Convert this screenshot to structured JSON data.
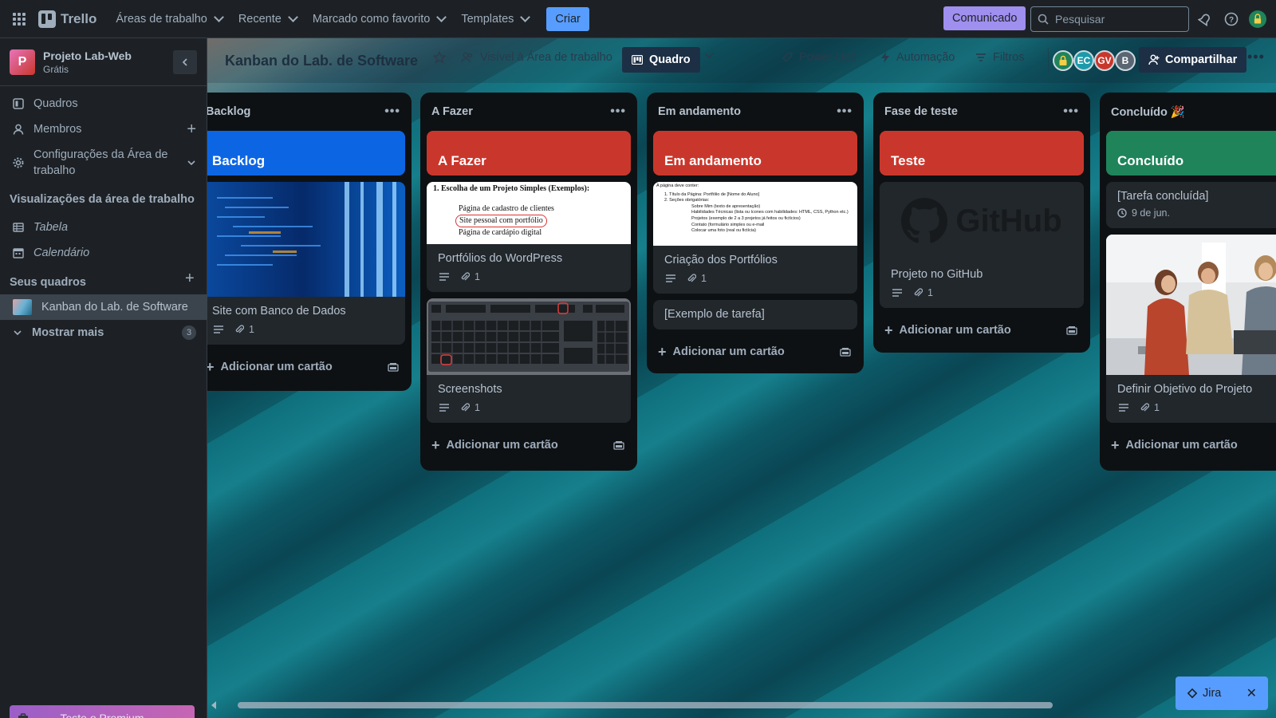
{
  "topnav": {
    "app_name": "Trello",
    "menus": [
      {
        "label": "Áreas de trabalho"
      },
      {
        "label": "Recente"
      },
      {
        "label": "Marcado como favorito"
      },
      {
        "label": "Templates"
      }
    ],
    "create_label": "Criar",
    "announcement_label": "Comunicado",
    "search_placeholder": "Pesquisar"
  },
  "sidebar": {
    "workspace_initial": "P",
    "workspace_name": "Projeto Lab-Web",
    "workspace_plan": "Grátis",
    "items": [
      {
        "label": "Quadros"
      },
      {
        "label": "Membros"
      },
      {
        "label": "Configurações da Área de trabalho"
      }
    ],
    "views_heading": "Visualizações da área de trabalho",
    "views": [
      {
        "label": "Tabela"
      },
      {
        "label": "Calendário"
      }
    ],
    "boards_heading": "Seus quadros",
    "boards": [
      {
        "label": "Kanban do Lab. de Software"
      }
    ],
    "show_more_label": "Mostrar mais",
    "show_more_count": "3",
    "premium_label": "Teste o Premium gratuitamente"
  },
  "board": {
    "title": "Kanban do Lab. de Software",
    "visibility": "Visível à Área de trabalho",
    "view": "Quadro",
    "powerups": "Power-Ups",
    "automation": "Automação",
    "filters": "Filtros",
    "members": [
      {
        "initials": "EC",
        "color": "#1d9aaa"
      },
      {
        "initials": "GV",
        "color": "#c9372c"
      },
      {
        "initials": "B",
        "color": "#5a6773"
      }
    ],
    "share_label": "Compartilhar"
  },
  "lists": [
    {
      "title": "Backlog",
      "cards": [
        {
          "banner": "Backlog",
          "banner_color": "#0c66e4"
        },
        {
          "title": "Site com Banco de Dados",
          "attachments": "1"
        }
      ],
      "add_label": "Adicionar um cartão"
    },
    {
      "title": "A Fazer",
      "cards": [
        {
          "banner": "A Fazer",
          "banner_color": "#c9372c"
        },
        {
          "title": "Portfólios do WordPress",
          "attachments": "1",
          "cover_heading": "1. Escolha de um Projeto Simples (Exemplos):",
          "cover_items": [
            "Página de cadastro de clientes",
            "Site pessoal com portfólio",
            "Página de cardápio digital"
          ]
        },
        {
          "title": "Screenshots",
          "attachments": "1"
        }
      ],
      "add_label": "Adicionar um cartão"
    },
    {
      "title": "Em andamento",
      "cards": [
        {
          "banner": "Em andamento",
          "banner_color": "#c9372c"
        },
        {
          "title": "Criação dos Portfólios",
          "attachments": "1",
          "cover_intro": "A página deve conter:",
          "cover_lines": [
            "1. Título da Página: Portfólio de [Nome do Aluno]",
            "2. Seções obrigatórias:",
            "Sobre Mim (texto de apresentação)",
            "Habilidades Técnicas (lista ou ícones com habilidades: HTML, CSS, Python etc.)",
            "Projetos (exemplo de 2 a 3 projetos já feitos ou fictícios)",
            "Contato (formulário simples ou e-mail",
            "Colocar uma foto (real ou fictícia)"
          ]
        },
        {
          "title": "[Exemplo de tarefa]"
        }
      ],
      "add_label": "Adicionar um cartão"
    },
    {
      "title": "Fase de teste",
      "cards": [
        {
          "banner": "Teste",
          "banner_color": "#c9372c"
        },
        {
          "title": "Projeto no GitHub",
          "attachments": "1",
          "cover_text": "GitHub"
        }
      ],
      "add_label": "Adicionar um cartão"
    },
    {
      "title": "Concluído 🎉",
      "cards": [
        {
          "banner": "Concluído",
          "banner_color": "#1f845a"
        },
        {
          "title": "[Tarefa concluída]",
          "date": "9 de jun."
        },
        {
          "title": "Definir Objetivo do Projeto",
          "attachments": "1"
        }
      ],
      "add_label": "Adicionar um cartão"
    }
  ],
  "jira": {
    "label": "Jira"
  }
}
